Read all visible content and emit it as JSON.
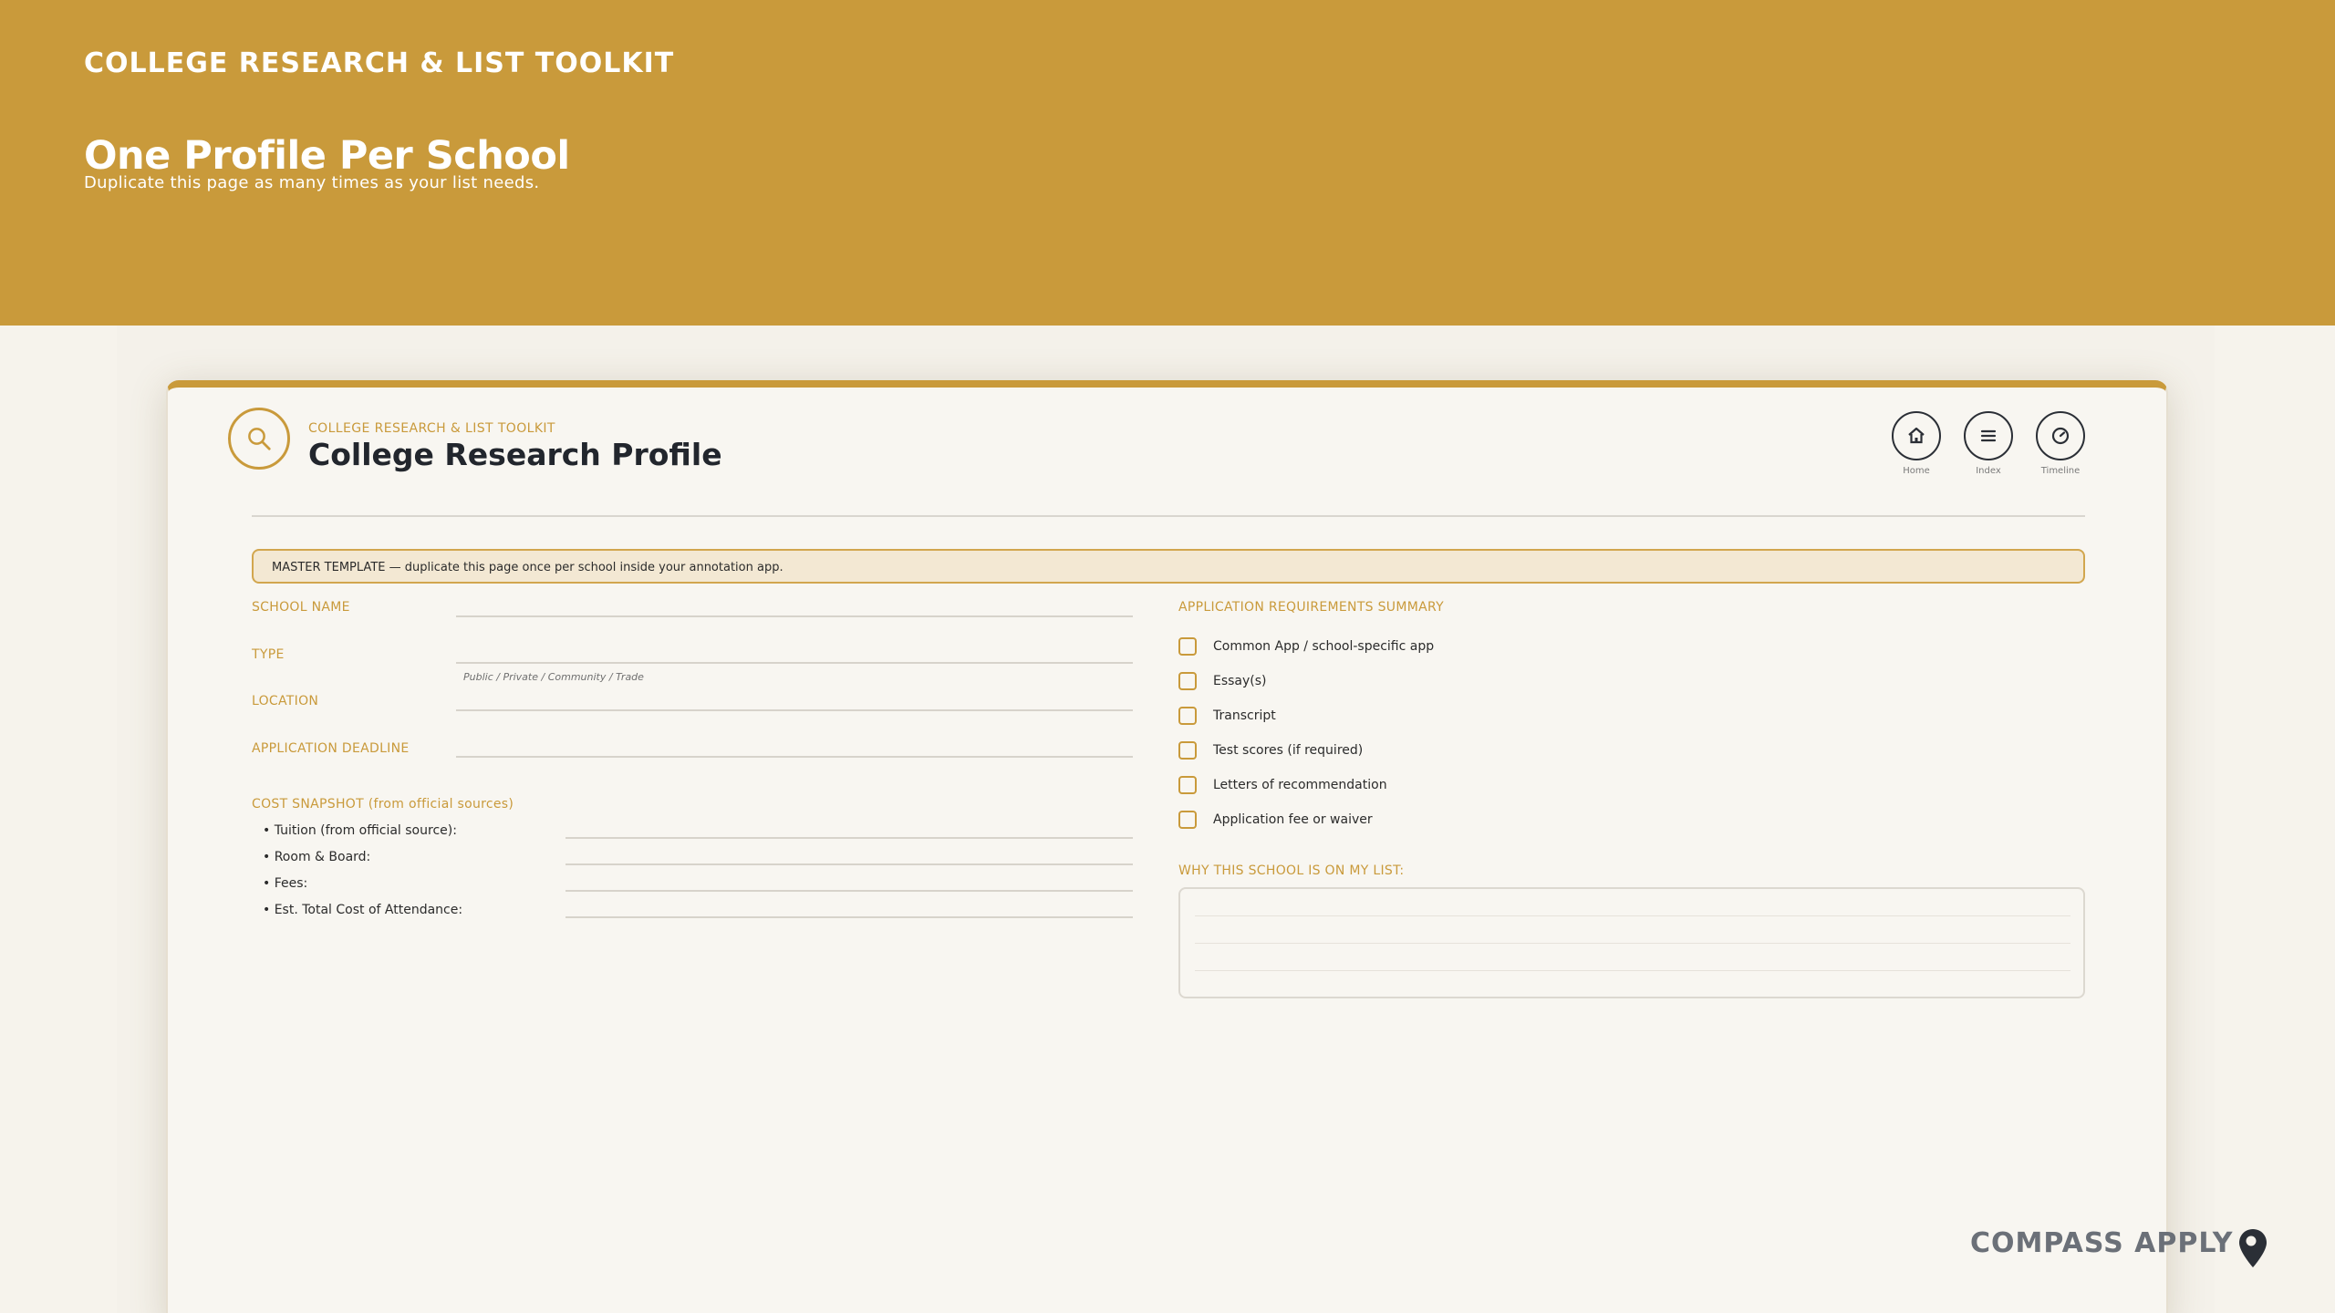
{
  "banner": {
    "kicker": "COLLEGE RESEARCH & LIST TOOLKIT",
    "title": "One Profile Per School",
    "subtitle": "Duplicate this page as many times as your list needs."
  },
  "card": {
    "kicker": "COLLEGE RESEARCH & LIST TOOLKIT",
    "title": "College Research Profile",
    "logo_icon": "search-icon",
    "nav": [
      {
        "label": "Home",
        "icon": "home-icon"
      },
      {
        "label": "Index",
        "icon": "menu-icon"
      },
      {
        "label": "Timeline",
        "icon": "clock-icon"
      }
    ],
    "notice": "MASTER TEMPLATE — duplicate this page once per school inside your annotation app."
  },
  "fields": {
    "school_name": "SCHOOL NAME",
    "type": "TYPE",
    "type_hint": "Public / Private / Community / Trade",
    "location": "LOCATION",
    "deadline": "APPLICATION DEADLINE"
  },
  "cost": {
    "heading": "COST SNAPSHOT (from official sources)",
    "items": [
      "• Tuition (from official source):",
      "• Room & Board:",
      "• Fees:",
      "• Est. Total Cost of Attendance:"
    ]
  },
  "requirements": {
    "heading": "APPLICATION REQUIREMENTS SUMMARY",
    "items": [
      "Common App / school-specific app",
      "Essay(s)",
      "Transcript",
      "Test scores (if required)",
      "Letters of recommendation",
      "Application fee or waiver"
    ]
  },
  "why": {
    "heading": "WHY THIS SCHOOL IS ON MY LIST:"
  },
  "brand": {
    "name": "COMPASS APPLY",
    "icon": "location-pin-icon"
  },
  "colors": {
    "accent": "#c99a3b",
    "ink": "#22262d",
    "background": "#f6f3ec"
  }
}
